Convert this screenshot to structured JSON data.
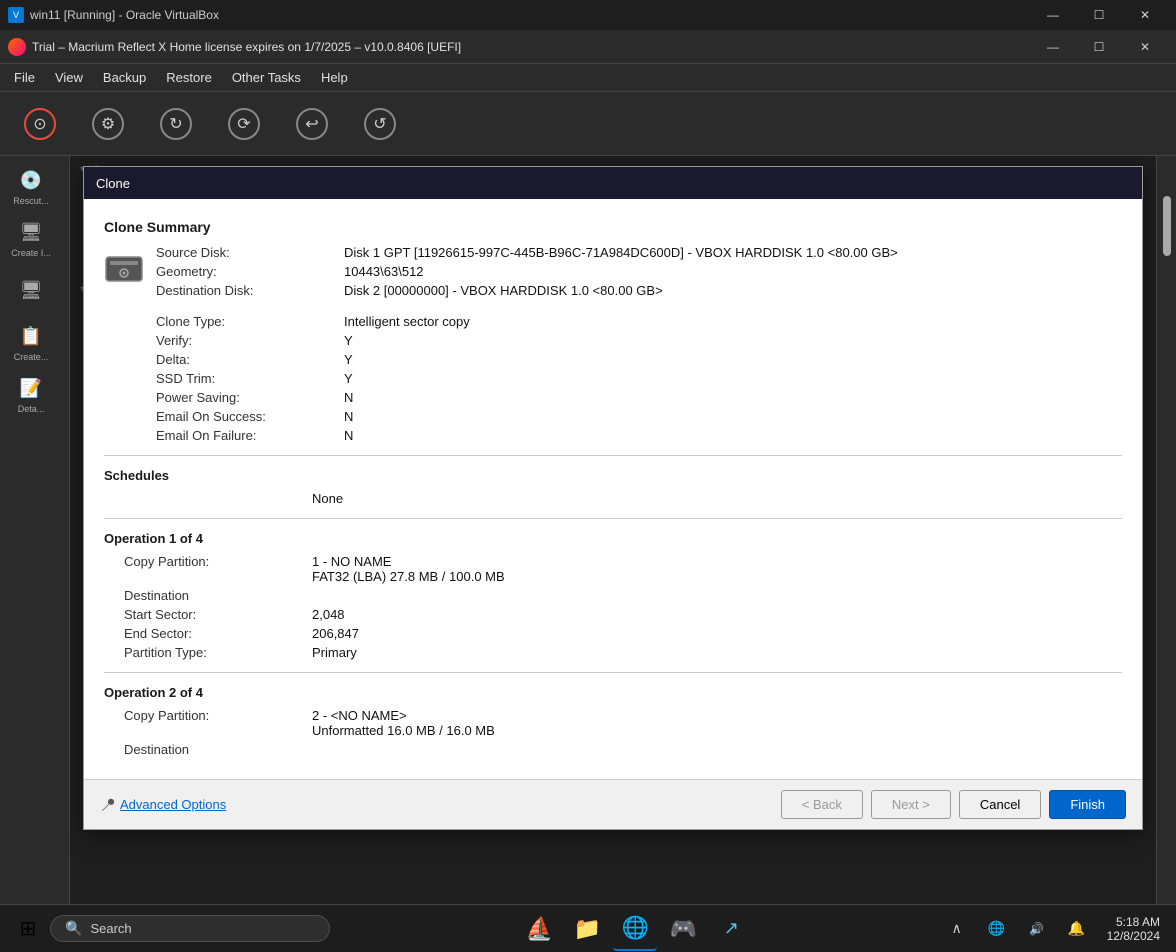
{
  "titlebar": {
    "title": "win11 [Running] - Oracle VirtualBox",
    "minimize": "—",
    "maximize": "☐",
    "close": "✕"
  },
  "app_titlebar": {
    "title": "Trial – Macrium Reflect X Home license expires on 1/7/2025 – v10.0.8406  [UEFI]",
    "minimize": "—",
    "maximize": "☐",
    "close": "✕"
  },
  "menu": {
    "items": [
      "File",
      "View",
      "Backup",
      "Restore",
      "Other Tasks",
      "Help"
    ]
  },
  "toolbar": {
    "buttons": [
      {
        "label": "",
        "icon": "⊙"
      },
      {
        "label": "",
        "icon": "⚙"
      },
      {
        "label": "",
        "icon": "↻"
      },
      {
        "label": "",
        "icon": "⟳"
      },
      {
        "label": "",
        "icon": "↩"
      },
      {
        "label": "",
        "icon": "↺"
      }
    ]
  },
  "sidebar": {
    "items": [
      {
        "label": "Rescut...",
        "icon": "💿"
      },
      {
        "label": "Create I...",
        "icon": "🖥"
      },
      {
        "label": "",
        "icon": "🖥"
      },
      {
        "label": "Create...",
        "icon": "📋"
      },
      {
        "label": "Deta...",
        "icon": "📝"
      }
    ]
  },
  "dialog": {
    "title": "Clone",
    "clone_summary": {
      "heading": "Clone Summary",
      "source_disk_label": "Source Disk:",
      "source_disk_value": "Disk 1 GPT [11926615-997C-445B-B96C-71A984DC600D] - VBOX HARDDISK 1.0  <80.00 GB>",
      "geometry_label": "Geometry:",
      "geometry_value": "10443\\63\\512",
      "destination_disk_label": "Destination Disk:",
      "destination_disk_value": "Disk 2 [00000000] - VBOX HARDDISK 1.0  <80.00 GB>",
      "clone_type_label": "Clone Type:",
      "clone_type_value": "Intelligent sector copy",
      "verify_label": "Verify:",
      "verify_value": "Y",
      "delta_label": "Delta:",
      "delta_value": "Y",
      "ssd_trim_label": "SSD Trim:",
      "ssd_trim_value": "Y",
      "power_saving_label": "Power Saving:",
      "power_saving_value": "N",
      "email_success_label": "Email On Success:",
      "email_success_value": "N",
      "email_failure_label": "Email On Failure:",
      "email_failure_value": "N"
    },
    "schedules": {
      "heading": "Schedules",
      "value": "None"
    },
    "operation1": {
      "heading": "Operation 1 of 4",
      "copy_partition_label": "Copy Partition:",
      "copy_partition_value": "1 - NO NAME",
      "copy_partition_detail": "FAT32 (LBA) 27.8 MB / 100.0 MB",
      "destination_label": "Destination",
      "start_sector_label": "Start Sector:",
      "start_sector_value": "2,048",
      "end_sector_label": "End Sector:",
      "end_sector_value": "206,847",
      "partition_type_label": "Partition Type:",
      "partition_type_value": "Primary"
    },
    "operation2": {
      "heading": "Operation 2 of 4",
      "copy_partition_label": "Copy Partition:",
      "copy_partition_value": "2 - <NO NAME>",
      "copy_partition_detail": "Unformatted 16.0 MB / 16.0 MB",
      "destination_label": "Destination"
    },
    "footer": {
      "advanced_options": "Advanced Options",
      "back_btn": "< Back",
      "next_btn": "Next >",
      "cancel_btn": "Cancel",
      "finish_btn": "Finish"
    }
  },
  "taskbar": {
    "search_placeholder": "Search",
    "clock": {
      "time": "5:18 AM",
      "date": "12/8/2024"
    },
    "apps": [
      {
        "icon": "⊞",
        "label": "Start"
      },
      {
        "icon": "🔍",
        "label": "Search"
      },
      {
        "icon": "⛵",
        "label": "App1"
      },
      {
        "icon": "📁",
        "label": "File Explorer"
      },
      {
        "icon": "🌐",
        "label": "Edge"
      },
      {
        "icon": "🎮",
        "label": "App2"
      },
      {
        "icon": "↗",
        "label": "App3"
      }
    ],
    "system_icons": [
      {
        "icon": "∧",
        "label": "Show hidden"
      },
      {
        "icon": "⊕",
        "label": "Network"
      },
      {
        "icon": "🌐",
        "label": "Globe"
      },
      {
        "icon": "🔔",
        "label": "Notifications"
      }
    ]
  }
}
